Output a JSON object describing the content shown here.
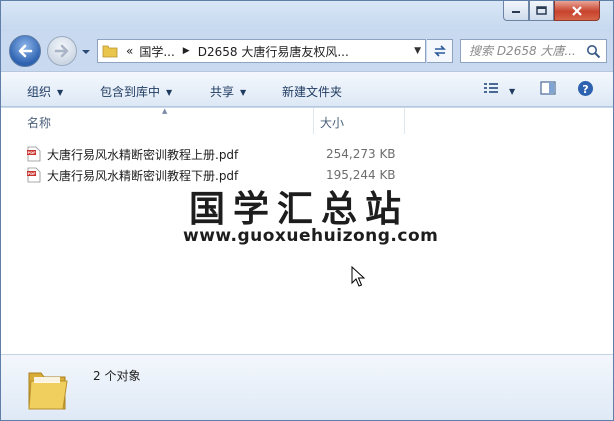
{
  "address": {
    "overflow": "«",
    "crumbs": [
      "国学...",
      "D2658 大唐行易唐友权风..."
    ]
  },
  "search": {
    "placeholder": "搜索 D2658 大唐..."
  },
  "toolbar": {
    "organize": "组织",
    "include_library": "包含到库中",
    "share": "共享",
    "new_folder": "新建文件夹"
  },
  "columns": {
    "name": "名称",
    "size": "大小"
  },
  "files": [
    {
      "name": "大唐行易风水精断密训教程上册.pdf",
      "size": "254,273 KB"
    },
    {
      "name": "大唐行易风水精断密训教程下册.pdf",
      "size": "195,244 KB"
    }
  ],
  "watermark": {
    "title": "国学汇总站",
    "url": "www.guoxuehuizong.com"
  },
  "details": {
    "count": "2 个对象"
  },
  "colors": {
    "accent": "#2d62b1",
    "pdf_red": "#c8302a",
    "folder_yellow": "#e9c64b"
  }
}
